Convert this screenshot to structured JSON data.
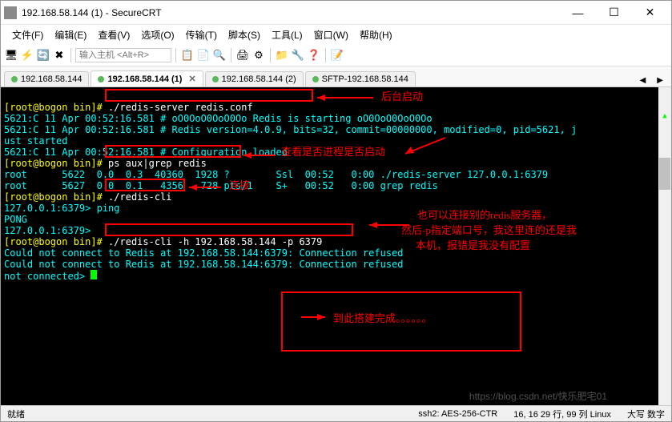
{
  "window": {
    "title": "192.168.58.144 (1) - SecureCRT"
  },
  "menu": {
    "file": "文件(F)",
    "edit": "编辑(E)",
    "view": "查看(V)",
    "options": "选项(O)",
    "transfer": "传输(T)",
    "script": "脚本(S)",
    "tools": "工具(L)",
    "window": "窗口(W)",
    "help": "帮助(H)"
  },
  "toolbar": {
    "host_placeholder": "输入主机 <Alt+R>"
  },
  "tabs": [
    {
      "label": "192.168.58.144"
    },
    {
      "label": "192.168.58.144 (1)",
      "active": true
    },
    {
      "label": "192.168.58.144 (2)"
    },
    {
      "label": "SFTP-192.168.58.144"
    }
  ],
  "term": {
    "l1a": "[root@bogon bin]# ",
    "l1b": "./redis-server redis.conf",
    "l2": "5621:C 11 Apr 00:52:16.581 # oO0OoO0OoO0Oo Redis is starting oO0OoO0OoO0Oo",
    "l3": "5621:C 11 Apr 00:52:16.581 # Redis version=4.0.9, bits=32, commit=00000000, modified=0, pid=5621, j",
    "l4": "ust started",
    "l5": "5621:C 11 Apr 00:52:16.581 # Configuration loaded",
    "l6a": "[root@bogon bin]# ",
    "l6b": "ps aux|grep redis",
    "l7": "root      5622  0.0  0.3  40360  1928 ?        Ssl  00:52   0:00 ./redis-server 127.0.0.1:6379",
    "l8": "root      5627  0.0  0.1   4356   728 pts/1    S+   00:52   0:00 grep redis",
    "l9a": "[root@bogon bin]# ",
    "l9b": "./redis-cli",
    "l10": "127.0.0.1:6379> ping",
    "l11": "PONG",
    "l12": "127.0.0.1:6379> ",
    "l13a": "[root@bogon bin]# ",
    "l13b": "./redis-cli -h 192.168.58.144 -p 6379",
    "l14": "Could not connect to Redis at 192.168.58.144:6379: Connection refused",
    "l15": "Could not connect to Redis at 192.168.58.144:6379: Connection refused",
    "l16": "not connected> "
  },
  "annotations": {
    "a1": "后台启动",
    "a2": "查看是否进程是否启动",
    "a3": "连接",
    "a4_1": "也可以连接别的redis服务器，",
    "a4_2": "然后-p指定端口号，我这里连的还是我",
    "a4_3": "本机，报错是我没有配置",
    "a5": "到此搭建完成。。。。。。"
  },
  "status": {
    "ready": "就绪",
    "cipher": "ssh2: AES-256-CTR",
    "pos": "16,  16  29 行, 99 列  Linux",
    "caps": "大写 数字"
  },
  "watermark": "https://blog.csdn.net/快乐肥宅01"
}
